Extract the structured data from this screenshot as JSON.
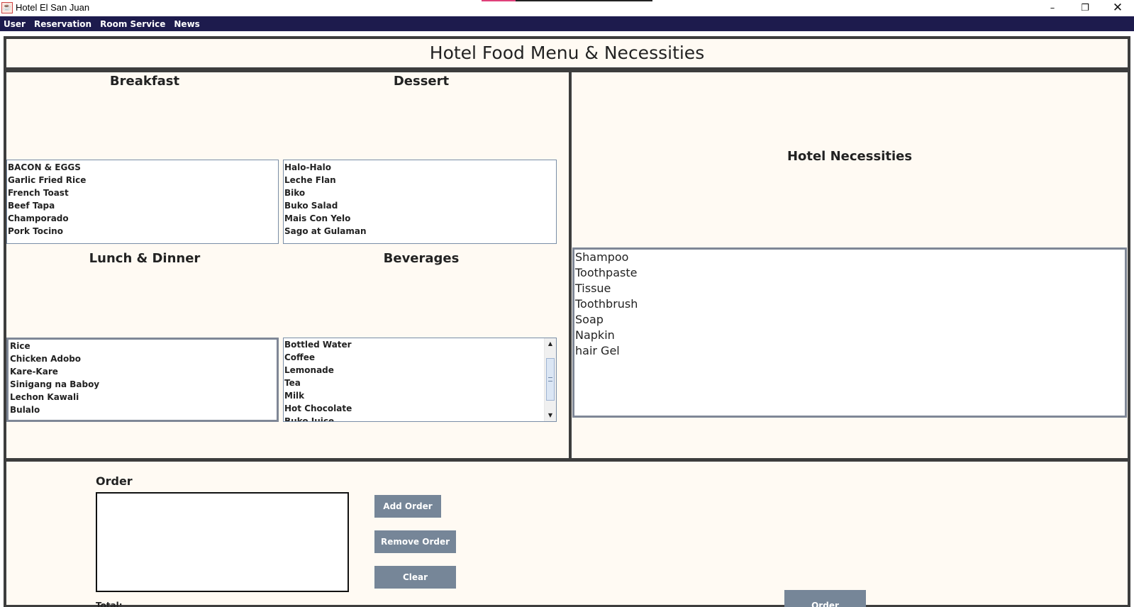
{
  "window": {
    "title": "Hotel El San Juan",
    "icon": "java-cup-icon",
    "controls": {
      "minimize": "–",
      "maximize": "❐",
      "close": "✕"
    }
  },
  "menubar": {
    "items": [
      "User",
      "Reservation",
      "Room Service",
      "News"
    ]
  },
  "header": {
    "title": "Hotel Food Menu & Necessities"
  },
  "food": {
    "breakfast": {
      "heading": "Breakfast",
      "items": [
        "BACON & EGGS",
        "Garlic Fried Rice",
        "French Toast",
        "Beef Tapa",
        "Champorado",
        "Pork Tocino"
      ]
    },
    "dessert": {
      "heading": "Dessert",
      "items": [
        "Halo-Halo",
        "Leche Flan",
        "Biko",
        "Buko Salad",
        "Mais Con Yelo",
        "Sago at Gulaman"
      ]
    },
    "lunch_dinner": {
      "heading": "Lunch & Dinner",
      "items": [
        "Rice",
        "Chicken Adobo",
        "Kare-Kare",
        "Sinigang na Baboy",
        "Lechon Kawali",
        "Bulalo"
      ]
    },
    "beverages": {
      "heading": "Beverages",
      "items": [
        "Bottled Water",
        "Coffee",
        "Lemonade",
        "Tea",
        "Milk",
        "Hot Chocolate",
        "Buko Juice"
      ],
      "scroll": {
        "up": "▲",
        "down": "▼"
      }
    }
  },
  "necessities": {
    "heading": "Hotel Necessities",
    "items": [
      "Shampoo",
      "Toothpaste",
      "Tissue",
      "Toothbrush",
      "Soap",
      "Napkin",
      "hair Gel"
    ]
  },
  "order": {
    "label": "Order",
    "add_label": "Add Order",
    "remove_label": "Remove Order",
    "clear_label": "Clear",
    "total_label": "Total:",
    "order_label": "Order"
  },
  "colors": {
    "menubar": "#1d1b4d",
    "panel_bg": "#fffaf3",
    "panel_border": "#3d3d3d",
    "button": "#768698"
  }
}
